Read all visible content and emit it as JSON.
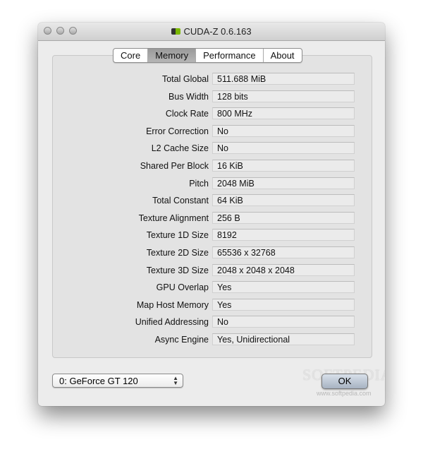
{
  "window": {
    "title": "CUDA-Z 0.6.163"
  },
  "tabs": [
    {
      "label": "Core"
    },
    {
      "label": "Memory",
      "active": true
    },
    {
      "label": "Performance"
    },
    {
      "label": "About"
    }
  ],
  "rows": [
    {
      "label": "Total Global",
      "value": "511.688 MiB"
    },
    {
      "label": "Bus Width",
      "value": "128 bits"
    },
    {
      "label": "Clock Rate",
      "value": "800 MHz"
    },
    {
      "label": "Error Correction",
      "value": "No"
    },
    {
      "label": "L2 Cache Size",
      "value": "No"
    },
    {
      "label": "Shared Per Block",
      "value": "16 KiB"
    },
    {
      "label": "Pitch",
      "value": "2048 MiB"
    },
    {
      "label": "Total Constant",
      "value": "64 KiB"
    },
    {
      "label": "Texture Alignment",
      "value": "256 B"
    },
    {
      "label": "Texture 1D Size",
      "value": "8192"
    },
    {
      "label": "Texture 2D Size",
      "value": "65536 x 32768"
    },
    {
      "label": "Texture 3D Size",
      "value": "2048 x 2048 x 2048"
    },
    {
      "label": "GPU Overlap",
      "value": "Yes"
    },
    {
      "label": "Map Host Memory",
      "value": "Yes"
    },
    {
      "label": "Unified Addressing",
      "value": "No"
    },
    {
      "label": "Async Engine",
      "value": "Yes, Unidirectional"
    }
  ],
  "device_select": {
    "value": "0: GeForce GT 120"
  },
  "ok_label": "OK",
  "watermark": {
    "text": "SOFTPEDIA",
    "url": "www.softpedia.com"
  }
}
